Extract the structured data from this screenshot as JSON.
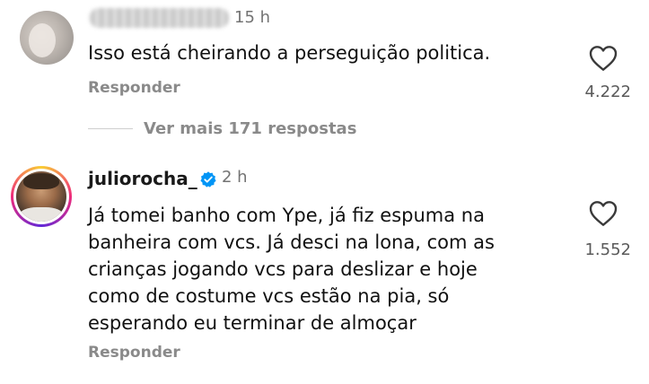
{
  "comments": [
    {
      "username_redacted": true,
      "time": "15 h",
      "text": "Isso está cheirando a perseguição politica.",
      "reply_label": "Responder",
      "likes": "4.222",
      "like_icon": "heart-outline-icon"
    },
    {
      "username": "juliorocha_",
      "verified": true,
      "time": "2 h",
      "text": "Já tomei banho com Ype, já fiz espuma na\nbanheira com vcs. Já desci na lona, com as\ncrianças jogando vcs para deslizar e hoje\ncomo de costume vcs estão na pia, só\nesperando eu terminar de almoçar",
      "reply_label": "Responder",
      "likes": "1.552",
      "like_icon": "heart-outline-icon"
    }
  ],
  "view_more_replies": "Ver mais 171 respostas",
  "colors": {
    "text": "#111111",
    "muted": "#8a8a8a",
    "verified_blue": "#0095f6"
  }
}
